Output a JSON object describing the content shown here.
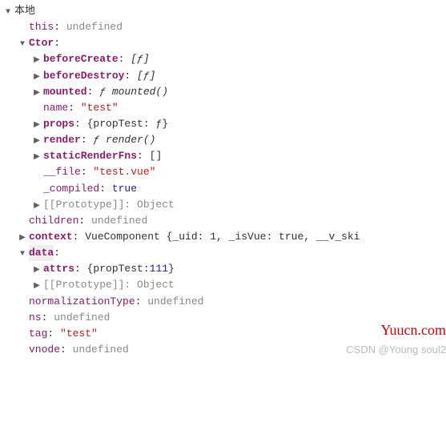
{
  "root": {
    "label": "本地",
    "this_key": "this",
    "this_val": "undefined",
    "ctor_key": "Ctor",
    "ctor": {
      "beforeCreate_key": "beforeCreate",
      "beforeCreate_val": "[ƒ]",
      "beforeDestroy_key": "beforeDestroy",
      "beforeDestroy_val": "[ƒ]",
      "mounted_key": "mounted",
      "mounted_val": "ƒ mounted()",
      "name_key": "name",
      "name_val": "\"test\"",
      "props_key": "props",
      "props_val": "{propTest: ƒ}",
      "render_key": "render",
      "render_val": "ƒ render()",
      "staticRenderFns_key": "staticRenderFns",
      "staticRenderFns_val": "[]",
      "file_key": "__file",
      "file_val": "\"test.vue\"",
      "compiled_key": "_compiled",
      "compiled_val": "true",
      "prototype_key": "[[Prototype]]",
      "prototype_val": "Object"
    },
    "children_key": "children",
    "children_val": "undefined",
    "context_key": "context",
    "context_val": "VueComponent {_uid: 1, _isVue: true, __v_ski",
    "data_key": "data",
    "data": {
      "attrs_key": "attrs",
      "attrs_val_open": "{propTest: ",
      "attrs_val_num": "111",
      "attrs_val_close": "}",
      "prototype_key": "[[Prototype]]",
      "prototype_val": "Object"
    },
    "normalizationType_key": "normalizationType",
    "normalizationType_val": "undefined",
    "ns_key": "ns",
    "ns_val": "undefined",
    "tag_key": "tag",
    "tag_val": "\"test\"",
    "vnode_key": "vnode",
    "vnode_val": "undefined"
  },
  "watermarks": {
    "site": "Yuucn.com",
    "csdn": "CSDN @Young soul2"
  }
}
